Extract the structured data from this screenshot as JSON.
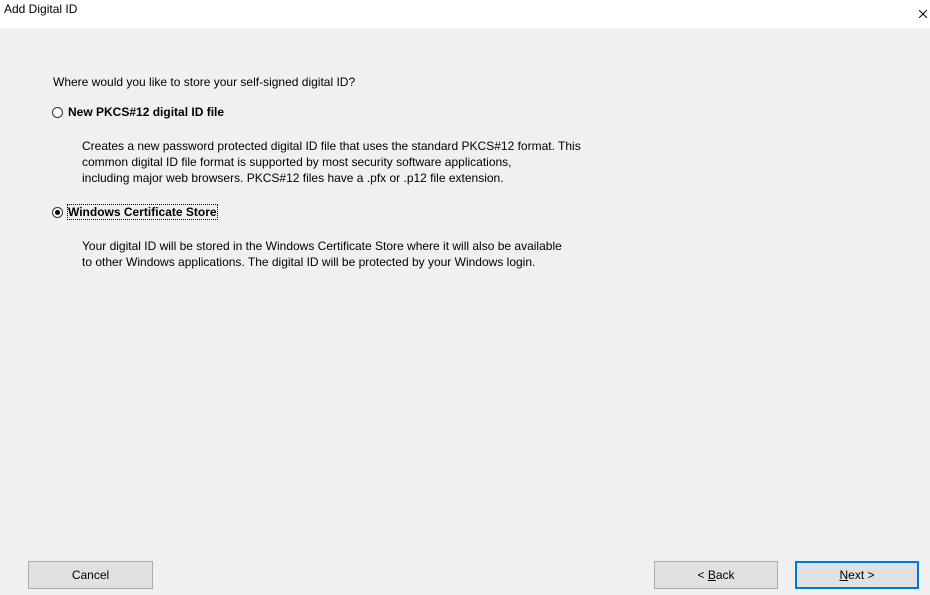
{
  "window": {
    "title": "Add Digital ID",
    "close_glyph": "close-icon"
  },
  "main": {
    "question": "Where would you like to store your self-signed digital ID?",
    "options": [
      {
        "label": "New PKCS#12 digital ID file",
        "selected": false,
        "description": [
          "Creates a new password protected digital ID file that uses the standard PKCS#12 format. This",
          "common digital ID file format is supported by most security software applications,",
          "including major web browsers. PKCS#12 files have a .pfx or .p12 file extension."
        ]
      },
      {
        "label": "Windows Certificate Store",
        "selected": true,
        "description": [
          "Your digital ID will be stored in the Windows Certificate Store where it will also be available",
          "to other Windows applications. The digital ID will be protected by your Windows login."
        ]
      }
    ]
  },
  "buttons": {
    "cancel": "Cancel",
    "back_prefix": "< ",
    "back_mnemonic": "B",
    "back_rest": "ack",
    "next_mnemonic": "N",
    "next_rest": "ext >"
  },
  "colors": {
    "dialog_bg": "#f0f0f0",
    "titlebar_bg": "#ffffff",
    "button_bg": "#e1e1e1",
    "default_button_border": "#0078d7"
  }
}
